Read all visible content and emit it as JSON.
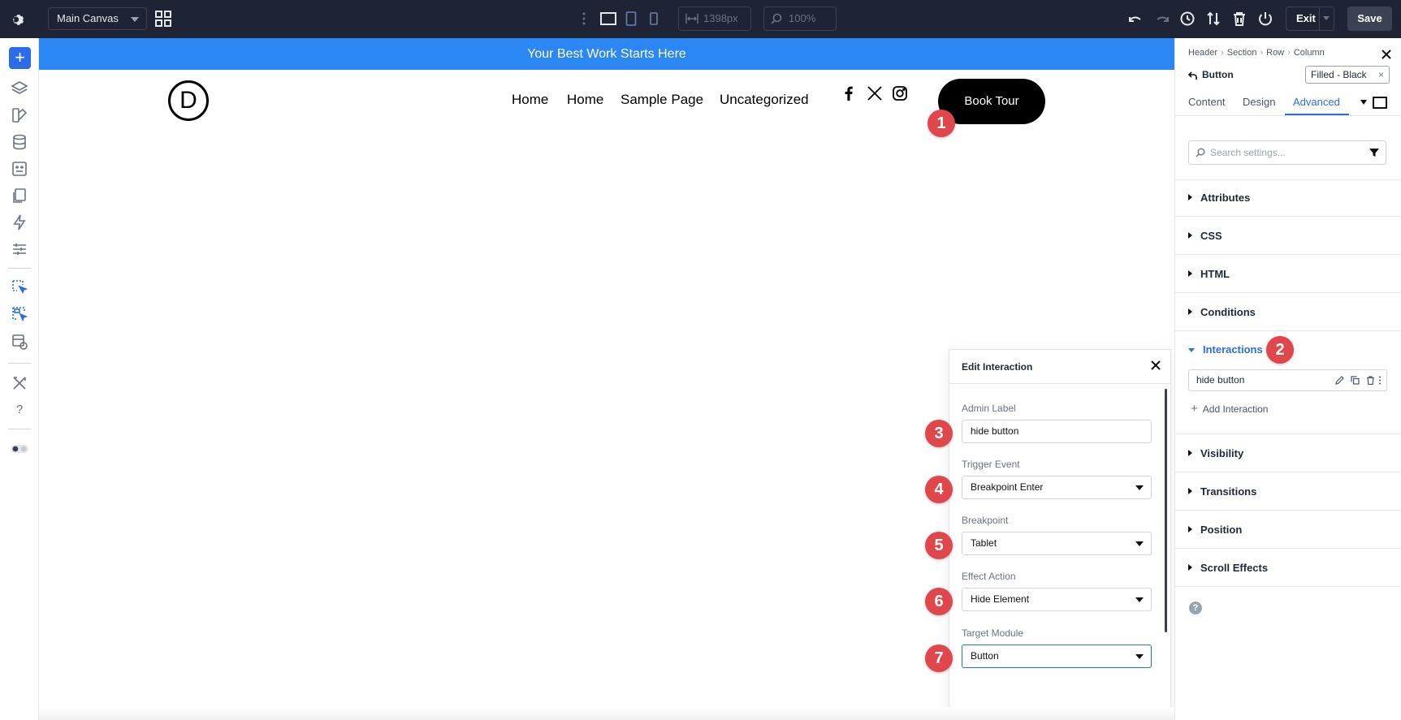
{
  "topbar": {
    "canvas_select": "Main Canvas",
    "width_value": "1398px",
    "zoom_value": "100%",
    "exit_label": "Exit",
    "save_label": "Save"
  },
  "canvas": {
    "banner_text": "Your Best Work Starts Here",
    "logo_letter": "D",
    "nav_items": [
      "Home",
      "Home",
      "Sample Page",
      "Uncategorized"
    ],
    "cta_label": "Book Tour",
    "badges": [
      "1",
      "2",
      "3",
      "4",
      "5",
      "6",
      "7"
    ]
  },
  "edit_interaction": {
    "title": "Edit Interaction",
    "admin_label": {
      "label": "Admin Label",
      "value": "hide button"
    },
    "trigger_event": {
      "label": "Trigger Event",
      "value": "Breakpoint Enter"
    },
    "breakpoint": {
      "label": "Breakpoint",
      "value": "Tablet"
    },
    "effect_action": {
      "label": "Effect Action",
      "value": "Hide Element"
    },
    "target_module": {
      "label": "Target Module",
      "value": "Button"
    }
  },
  "right_panel": {
    "breadcrumb": [
      "Header",
      "Section",
      "Row",
      "Column"
    ],
    "module_name": "Button",
    "preset": "Filled - Black",
    "tabs": [
      "Content",
      "Design",
      "Advanced"
    ],
    "active_tab": "Advanced",
    "search_placeholder": "Search settings...",
    "groups": [
      "Attributes",
      "CSS",
      "HTML",
      "Conditions",
      "Interactions",
      "Visibility",
      "Transitions",
      "Position",
      "Scroll Effects"
    ],
    "interaction_item": "hide button",
    "add_interaction": "Add Interaction"
  },
  "colors": {
    "accent": "#2b6ce8",
    "banner": "#2b87f3",
    "badge": "#e0474c",
    "topbar": "#1e2433"
  }
}
